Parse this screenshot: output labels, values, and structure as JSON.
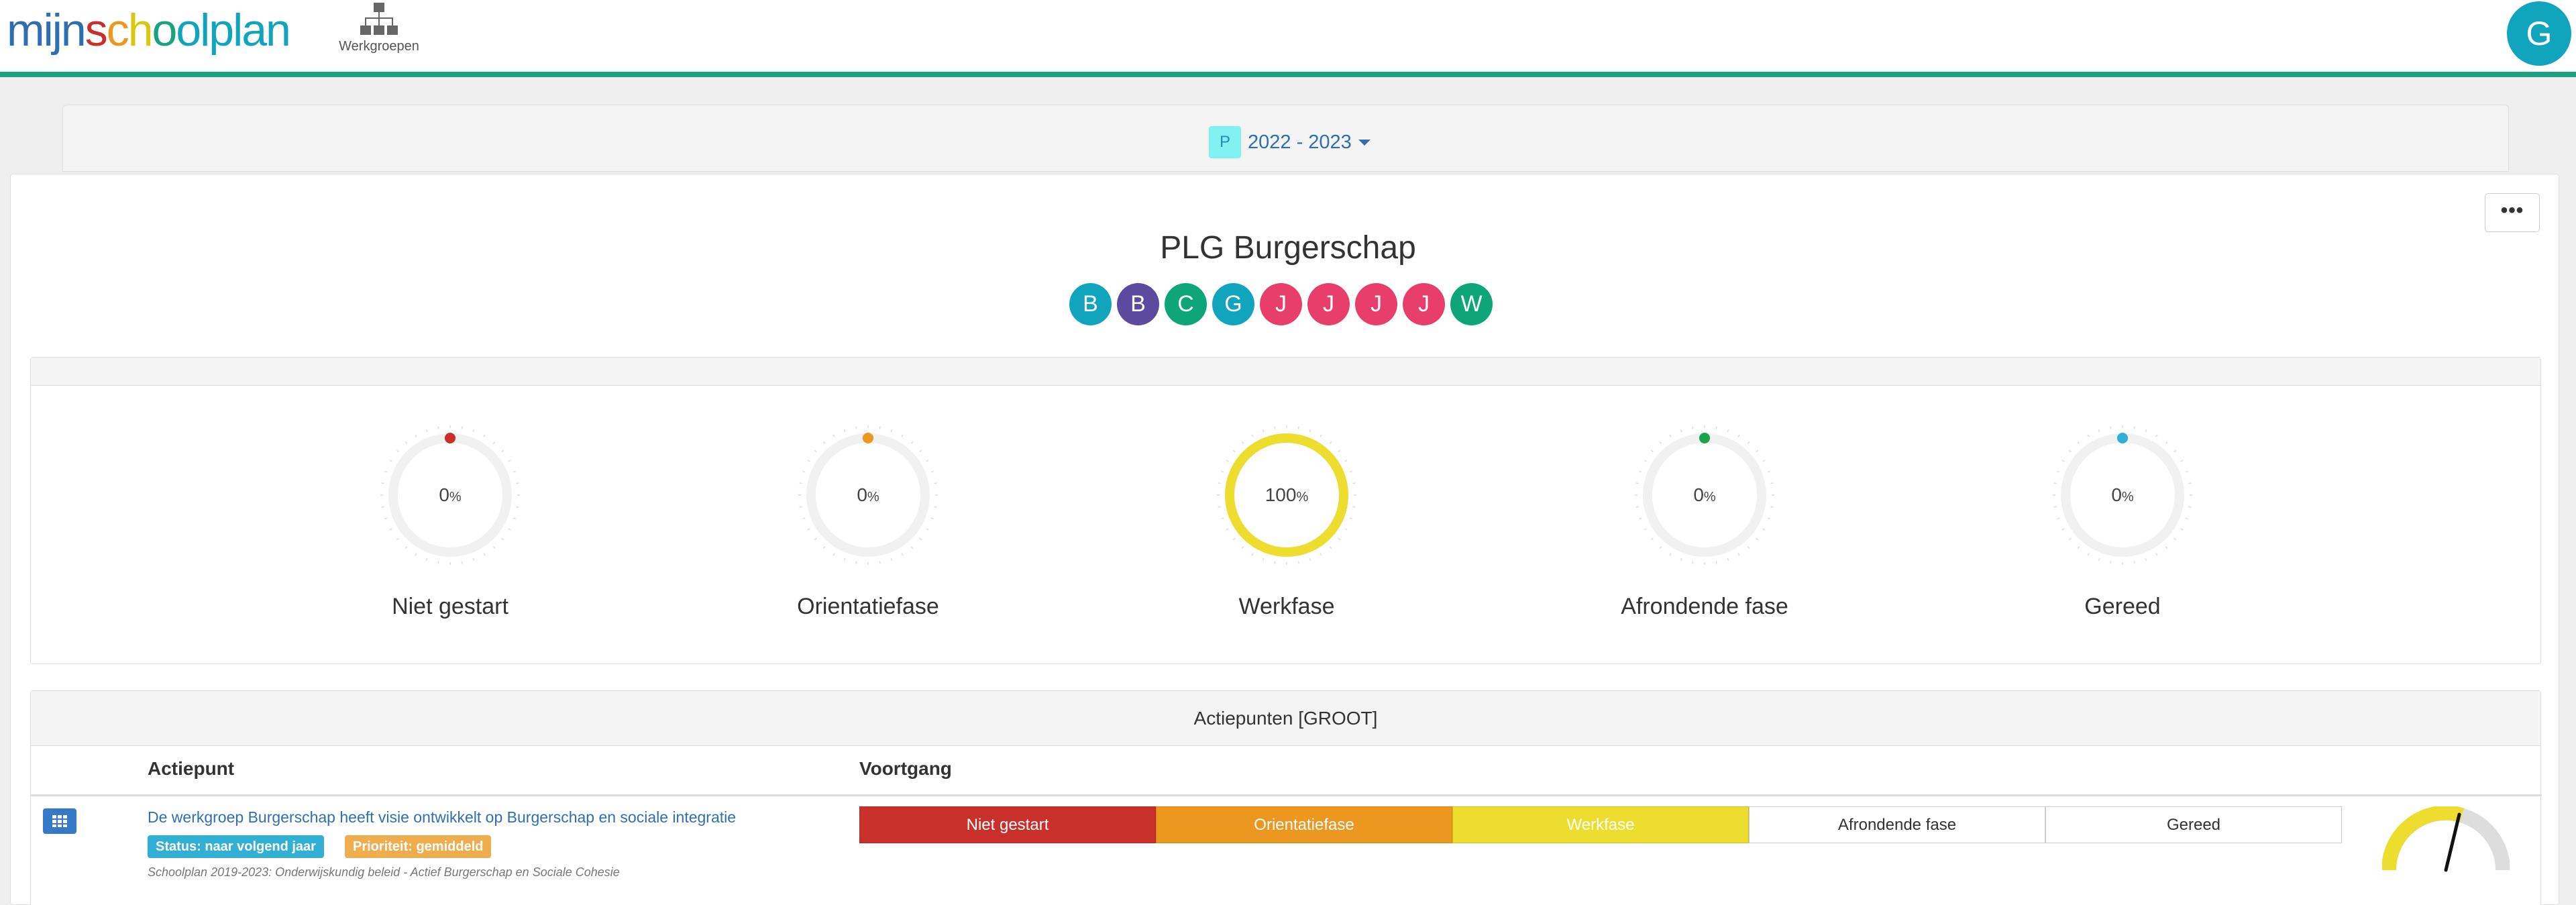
{
  "header": {
    "logo_parts": [
      {
        "text": "mijn",
        "color": "#2f6fb0"
      },
      {
        "text": "s",
        "color": "#c9302c"
      },
      {
        "text": "c",
        "color": "#ec971f"
      },
      {
        "text": "h",
        "color": "#ecdd2f"
      },
      {
        "text": "o",
        "color": "#1aa37f"
      },
      {
        "text": "o",
        "color": "#11a4bd"
      },
      {
        "text": "lplan",
        "color": "#11a4bd"
      }
    ],
    "workgroups_label": "Werkgroepen",
    "workgroups_icon": "sitemap-icon",
    "user_initial": "G",
    "accent_color": "#1aa37f"
  },
  "year_selector": {
    "badge": "P",
    "label": "2022 - 2023"
  },
  "page": {
    "more_label": "•••",
    "title": "PLG Burgerschap",
    "members": [
      {
        "initial": "B",
        "color": "#11a4bd"
      },
      {
        "initial": "B",
        "color": "#5b4a9e"
      },
      {
        "initial": "C",
        "color": "#0ea57a"
      },
      {
        "initial": "G",
        "color": "#11a4bd"
      },
      {
        "initial": "J",
        "color": "#e83e6c"
      },
      {
        "initial": "J",
        "color": "#e83e6c"
      },
      {
        "initial": "J",
        "color": "#e83e6c"
      },
      {
        "initial": "J",
        "color": "#e83e6c"
      },
      {
        "initial": "W",
        "color": "#0ea57a"
      }
    ]
  },
  "phases": [
    {
      "label": "Niet gestart",
      "value": 0,
      "color": "#c9302c"
    },
    {
      "label": "Orientatiefase",
      "value": 0,
      "color": "#ec971f"
    },
    {
      "label": "Werkfase",
      "value": 100,
      "color": "#ecdd2f"
    },
    {
      "label": "Afrondende fase",
      "value": 0,
      "color": "#1aa34a"
    },
    {
      "label": "Gereed",
      "value": 0,
      "color": "#31b0d5"
    }
  ],
  "percent_unit": "%",
  "action_points": {
    "title": "Actiepunten [GROOT]",
    "col_action": "Actiepunt",
    "col_progress": "Voortgang",
    "items": [
      {
        "title": "De werkgroep Burgerschap heeft visie ontwikkelt op Burgerschap en sociale integratie",
        "status_badge": "Status: naar volgend jaar",
        "priority_badge": "Prioriteit: gemiddeld",
        "source": "Schoolplan 2019-2023: Onderwijskundig beleid - Actief Burgerschap en Sociale Cohesie",
        "stages": [
          "Niet gestart",
          "Orientatiefase",
          "Werkfase",
          "Afrondende fase",
          "Gereed"
        ],
        "status_color": "#31b0d5",
        "priority_color": "#f0ad4e"
      }
    ]
  }
}
